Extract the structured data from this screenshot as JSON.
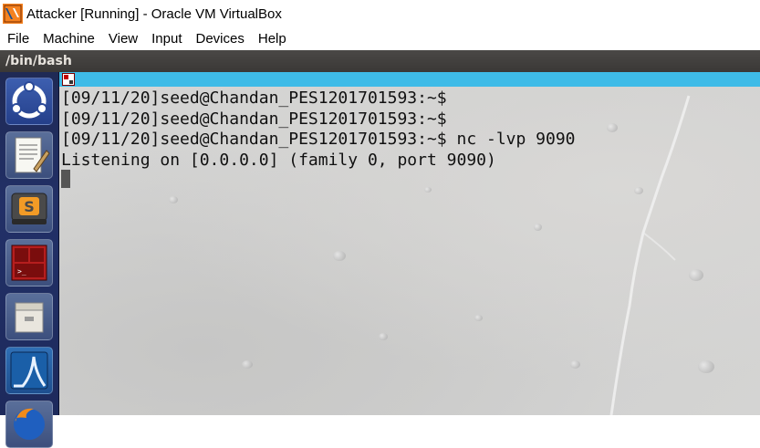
{
  "window": {
    "title": "Attacker [Running] - Oracle VM VirtualBox"
  },
  "menubar": {
    "items": [
      "File",
      "Machine",
      "View",
      "Input",
      "Devices",
      "Help"
    ]
  },
  "guest": {
    "topbar_title": "/bin/bash",
    "launcher_icons": [
      "ubuntu-dash-icon",
      "text-editor-icon",
      "sublime-text-icon",
      "terminator-icon",
      "file-cabinet-icon",
      "wireshark-icon",
      "firefox-icon"
    ]
  },
  "terminal": {
    "lines": [
      "[09/11/20]seed@Chandan_PES1201701593:~$",
      "[09/11/20]seed@Chandan_PES1201701593:~$",
      "[09/11/20]seed@Chandan_PES1201701593:~$ nc -lvp 9090",
      "Listening on [0.0.0.0] (family 0, port 9090)"
    ]
  },
  "colors": {
    "terminal_tabstrip": "#3ebbe7",
    "launcher": "#223067",
    "guest_topbar": "#3f3d3b"
  }
}
